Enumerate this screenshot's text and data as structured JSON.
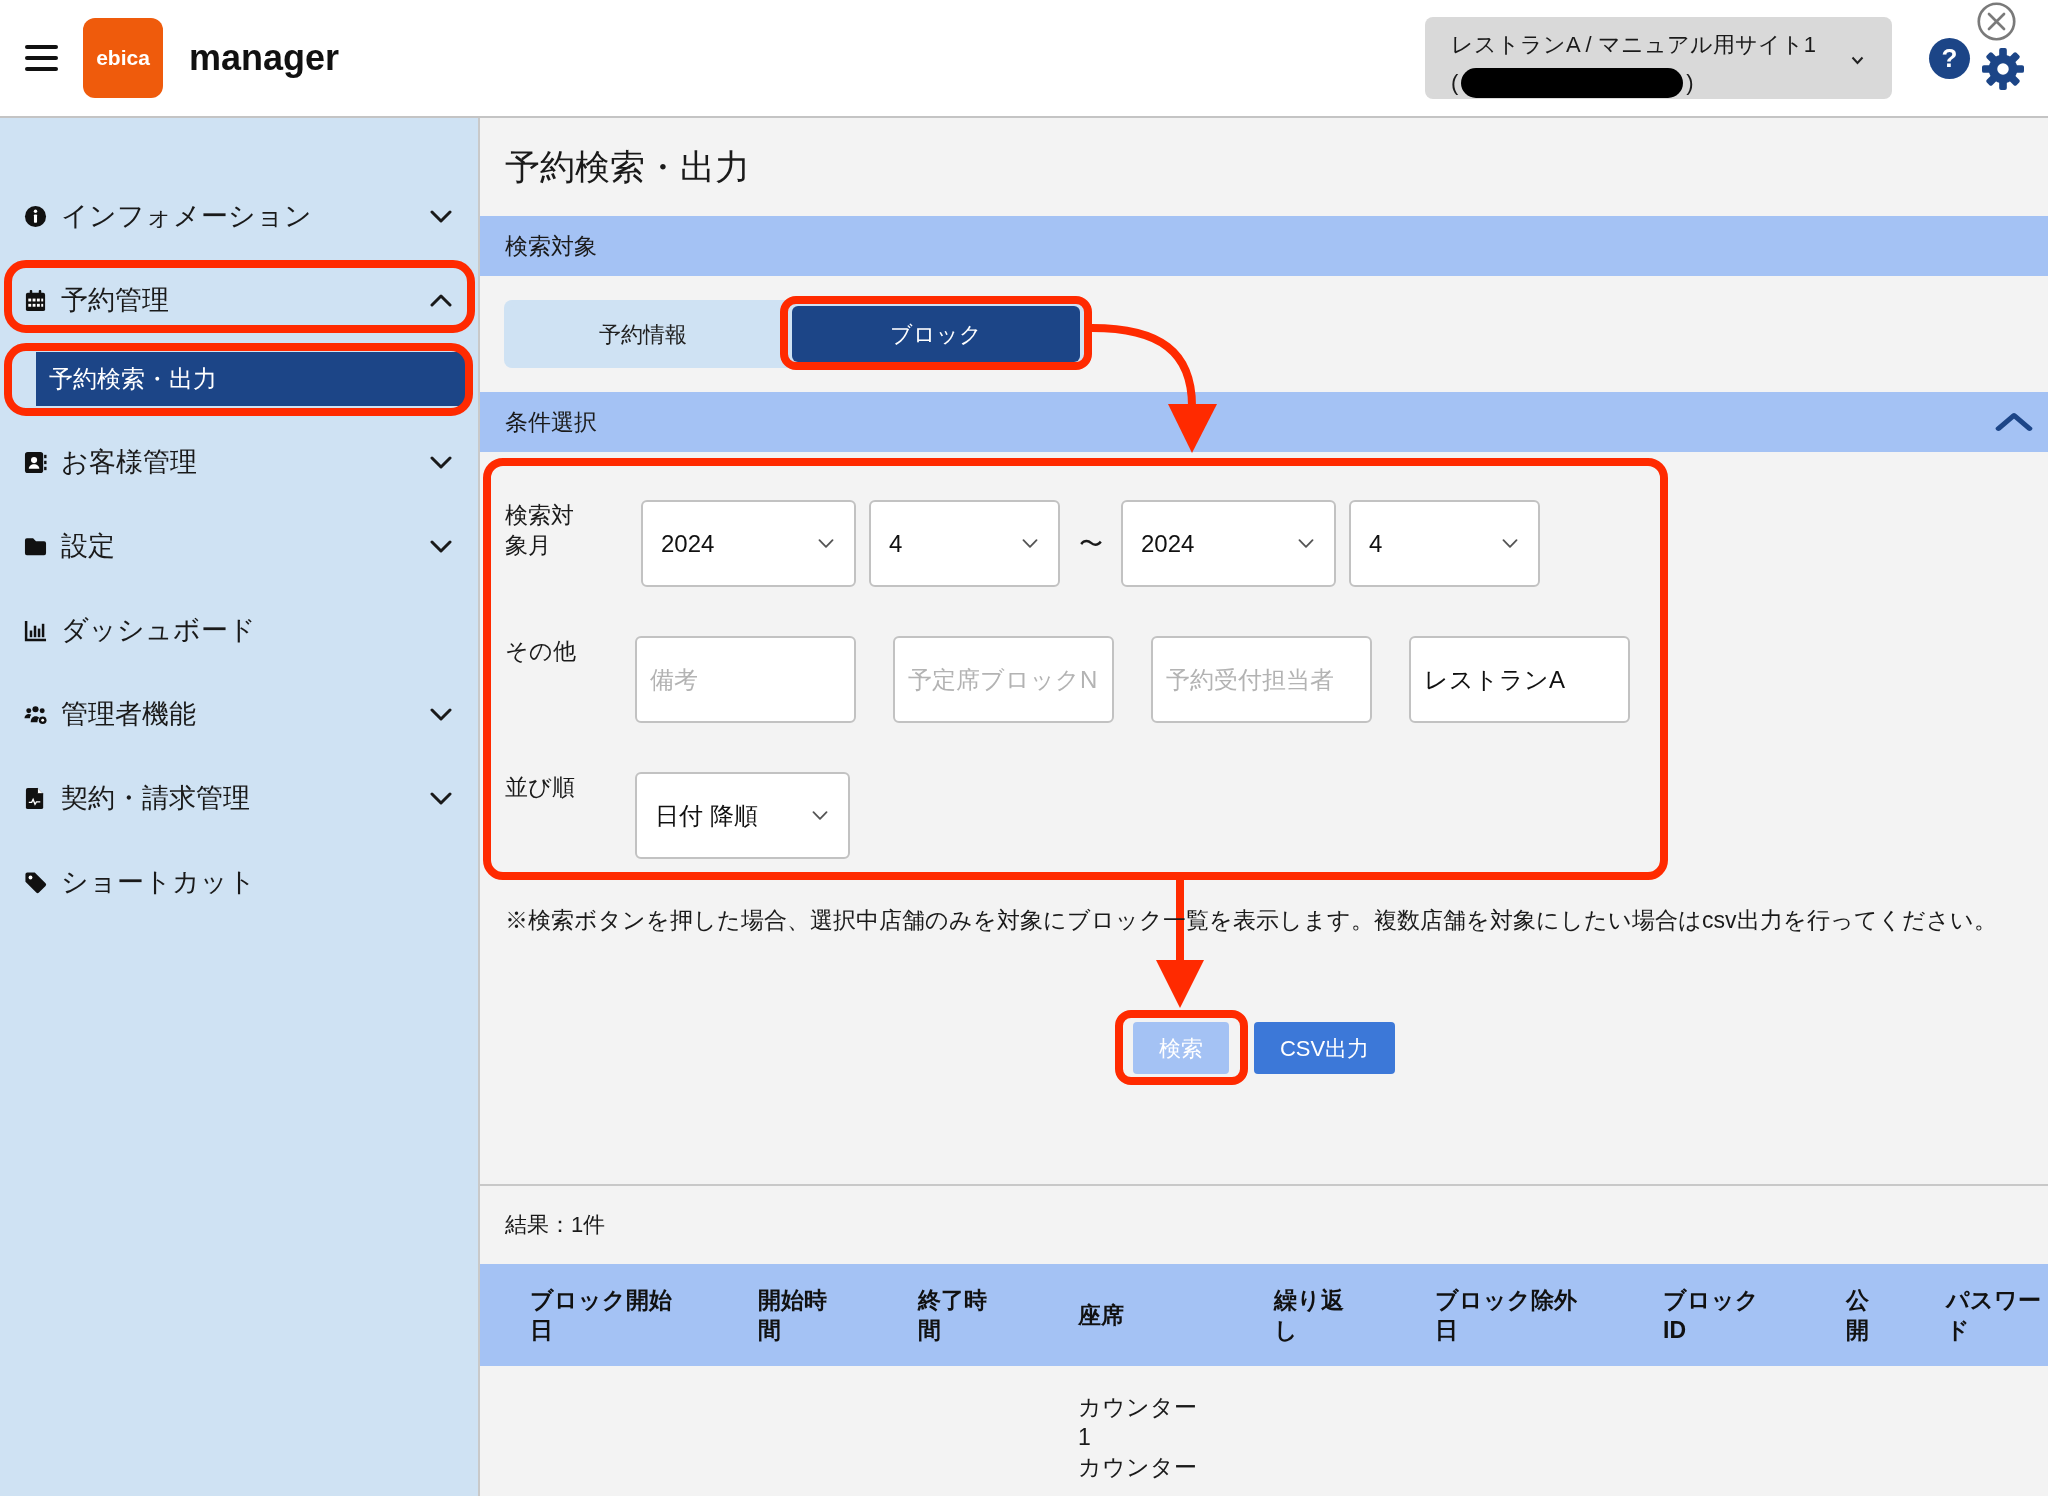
{
  "header": {
    "logo": {
      "text": "ebica"
    },
    "app_name": "manager",
    "store_selector": {
      "line_1": "レストランA / マニュアル用サイト1",
      "line_2_open": "(",
      "line_2_close": ")"
    },
    "help_button": {
      "label": "?"
    }
  },
  "sidebar": {
    "items": [
      {
        "label": "インフォメーション",
        "expanded": false,
        "highlighted": false
      },
      {
        "label": "予約管理",
        "expanded": true,
        "highlighted": true,
        "children": [
          {
            "label": "予約検索・出力",
            "selected": true,
            "highlighted": true
          }
        ]
      },
      {
        "label": "お客様管理",
        "expanded": false,
        "highlighted": false
      },
      {
        "label": "設定",
        "expanded": false,
        "highlighted": false
      },
      {
        "label": "ダッシュボード",
        "highlighted": false
      },
      {
        "label": "管理者機能",
        "expanded": false,
        "highlighted": false
      },
      {
        "label": "契約・請求管理",
        "expanded": false,
        "highlighted": false
      },
      {
        "label": "ショートカット",
        "highlighted": false
      }
    ]
  },
  "page_title": "予約検索・出力",
  "search_target": {
    "heading": "検索対象",
    "tabs": [
      {
        "label": "予約情報",
        "selected": false,
        "highlighted": false
      },
      {
        "label": "ブロック",
        "selected": true,
        "highlighted": true
      }
    ]
  },
  "conditions": {
    "heading": "条件選択",
    "expanded": true,
    "highlighted": true,
    "month_range": {
      "label": "検索対象月",
      "from_year": "2024",
      "from_month": "4",
      "separator": "〜",
      "to_year": "2024",
      "to_month": "4"
    },
    "other": {
      "label": "その他",
      "fields": [
        {
          "placeholder": "備考"
        },
        {
          "placeholder": "予定席ブロックN"
        },
        {
          "placeholder": "予約受付担当者"
        },
        {
          "value": "レストランA"
        }
      ]
    },
    "sort": {
      "label": "並び順",
      "value": "日付 降順"
    }
  },
  "note": "※検索ボタンを押した場合、選択中店舗のみを対象にブロック一覧を表示します。複数店舗を対象にしたい場合はcsv出力を行ってください。",
  "buttons": [
    {
      "label": "検索",
      "disabled": true,
      "highlighted": true
    },
    {
      "label": "CSV出力",
      "disabled": false,
      "highlighted": false
    }
  ],
  "results": {
    "summary": "結果：1件",
    "columns": [
      "ブロック開始日",
      "開始時間",
      "終了時間",
      "座席",
      "繰り返し",
      "ブロック除外日",
      "ブロックID",
      "公開",
      "パスワード"
    ],
    "rows": [
      {
        "seat": [
          "カウンター1",
          "カウンター"
        ]
      }
    ]
  }
}
